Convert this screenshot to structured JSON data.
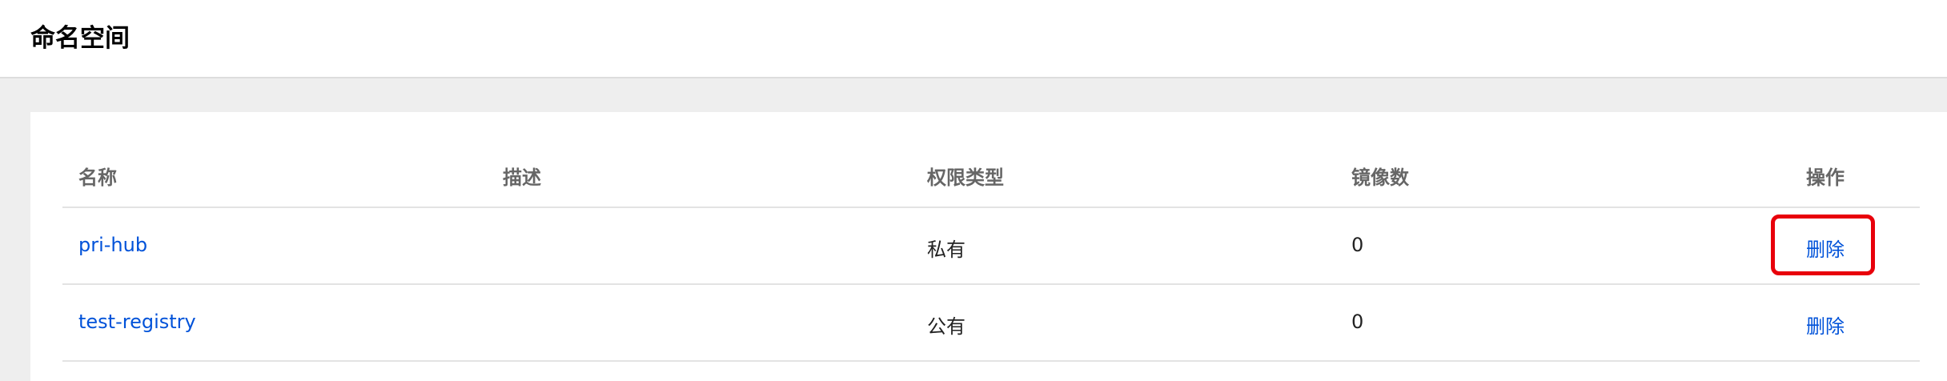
{
  "header": {
    "title": "命名空间"
  },
  "table": {
    "columns": [
      "名称",
      "描述",
      "权限类型",
      "镜像数",
      "操作"
    ],
    "rows": [
      {
        "name": "pri-hub",
        "description": "",
        "permission": "私有",
        "image_count": "0",
        "action": "删除"
      },
      {
        "name": "test-registry",
        "description": "",
        "permission": "公有",
        "image_count": "0",
        "action": "删除"
      }
    ]
  },
  "colors": {
    "link": "#0052d9",
    "highlight": "#e8000b"
  }
}
